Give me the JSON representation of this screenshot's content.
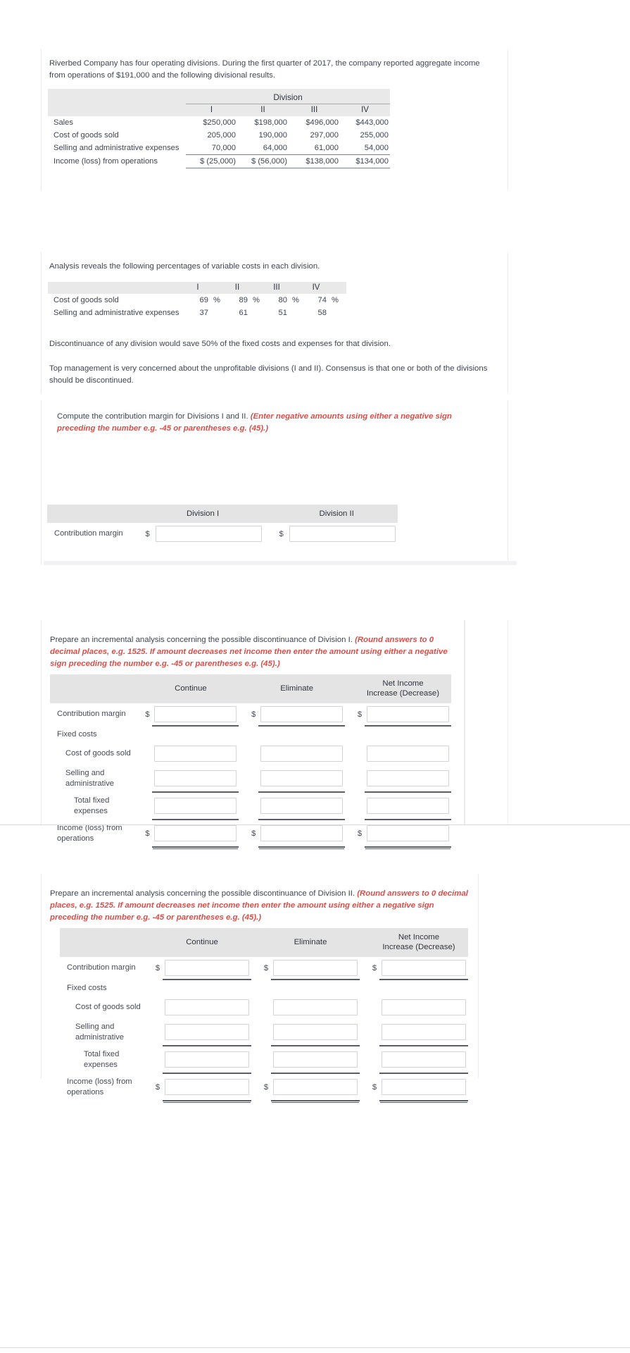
{
  "intro": {
    "paragraph": "Riverbed Company has four operating divisions. During the first quarter of 2017, the company reported aggregate income from operations of $191,000 and the following divisional results."
  },
  "division_table": {
    "group_header": "Division",
    "columns": [
      "I",
      "II",
      "III",
      "IV"
    ],
    "rows": [
      {
        "label": "Sales",
        "values": [
          "$250,000",
          "$198,000",
          "$496,000",
          "$443,000"
        ]
      },
      {
        "label": "Cost of goods sold",
        "values": [
          "205,000",
          "190,000",
          "297,000",
          "255,000"
        ]
      },
      {
        "label": "Selling and administrative expenses",
        "values": [
          "70,000",
          "64,000",
          "61,000",
          "54,000"
        ]
      },
      {
        "label": "Income (loss) from operations",
        "values": [
          "$ (25,000)",
          "$ (56,000)",
          "$138,000",
          "$134,000"
        ]
      }
    ]
  },
  "analysis": {
    "paragraph": "Analysis reveals the following percentages of variable costs in each division.",
    "columns": [
      "I",
      "II",
      "III",
      "IV"
    ],
    "rows": [
      {
        "label": "Cost of goods sold",
        "values": [
          "69",
          "89",
          "80",
          "74"
        ],
        "suffix": "%"
      },
      {
        "label": "Selling and administrative expenses",
        "values": [
          "37",
          "61",
          "51",
          "58"
        ],
        "suffix": ""
      }
    ],
    "percent_sign": "%"
  },
  "notes": {
    "discontinuance": "Discontinuance of any division would save 50% of the fixed costs and expenses for that division.",
    "management": "Top management is very concerned about the unprofitable divisions (I and II). Consensus is that one or both of the divisions should be discontinued."
  },
  "requirement_a": {
    "prompt_plain": "Compute the contribution margin for Divisions I and II. ",
    "prompt_red": "(Enter negative amounts using either a negative sign preceding the number e.g. -45 or parentheses e.g. (45).)",
    "table": {
      "headers": [
        "Division I",
        "Division II"
      ],
      "row_label": "Contribution margin",
      "dollar": "$",
      "values": [
        "",
        ""
      ],
      "placeholder": ""
    }
  },
  "requirement_b": {
    "prompt_plain": "Prepare an incremental analysis concerning the possible discontinuance of Division I. ",
    "prompt_red": "(Round answers to 0 decimal places, e.g. 1525. If amount decreases net income then enter the amount using either a negative sign preceding the number e.g. -45 or parentheses e.g. (45).)",
    "headers": {
      "continue": "Continue",
      "eliminate": "Eliminate",
      "net_income_line1": "Net Income",
      "net_income_line2": "Increase (Decrease)"
    },
    "dollar": "$",
    "rows": [
      {
        "label": "Contribution margin",
        "indent": 0,
        "dollar": true,
        "rule": "single",
        "values": [
          "",
          "",
          ""
        ]
      },
      {
        "label": "Fixed costs",
        "indent": 0,
        "dollar": false,
        "rule": "none",
        "values": [
          null,
          null,
          null
        ]
      },
      {
        "label": "Cost of goods sold",
        "indent": 1,
        "dollar": false,
        "rule": "none",
        "values": [
          "",
          "",
          ""
        ]
      },
      {
        "label": "Selling and administrative",
        "indent": 1,
        "dollar": false,
        "rule": "single",
        "values": [
          "",
          "",
          ""
        ]
      },
      {
        "label": "Total fixed expenses",
        "indent": 2,
        "dollar": false,
        "rule": "single",
        "values": [
          "",
          "",
          ""
        ]
      },
      {
        "label": "Income (loss) from operations",
        "indent": 0,
        "dollar": true,
        "rule": "double",
        "values": [
          "",
          "",
          ""
        ]
      }
    ]
  },
  "requirement_c": {
    "prompt_plain": "Prepare an incremental analysis concerning the possible discontinuance of Division II. ",
    "prompt_red": "(Round answers to 0 decimal places, e.g. 1525. If amount decreases net income then enter the amount using either a negative sign preceding the number e.g. -45 or parentheses e.g. (45).)",
    "headers": {
      "continue": "Continue",
      "eliminate": "Eliminate",
      "net_income_line1": "Net Income",
      "net_income_line2": "Increase (Decrease)"
    },
    "dollar": "$",
    "rows": [
      {
        "label": "Contribution margin",
        "indent": 0,
        "dollar": true,
        "rule": "single",
        "values": [
          "",
          "",
          ""
        ]
      },
      {
        "label": "Fixed costs",
        "indent": 0,
        "dollar": false,
        "rule": "none",
        "values": [
          null,
          null,
          null
        ]
      },
      {
        "label": "Cost of goods sold",
        "indent": 1,
        "dollar": false,
        "rule": "none",
        "values": [
          "",
          "",
          ""
        ]
      },
      {
        "label": "Selling and administrative",
        "indent": 1,
        "dollar": false,
        "rule": "single",
        "values": [
          "",
          "",
          ""
        ]
      },
      {
        "label": "Total fixed expenses",
        "indent": 2,
        "dollar": false,
        "rule": "single",
        "values": [
          "",
          "",
          ""
        ]
      },
      {
        "label": "Income (loss) from operations",
        "indent": 0,
        "dollar": true,
        "rule": "double",
        "values": [
          "",
          "",
          ""
        ]
      }
    ]
  },
  "colors": {
    "red_instruction": "#d4504a",
    "header_band": "#e6e6e6",
    "text": "#3f4651"
  }
}
